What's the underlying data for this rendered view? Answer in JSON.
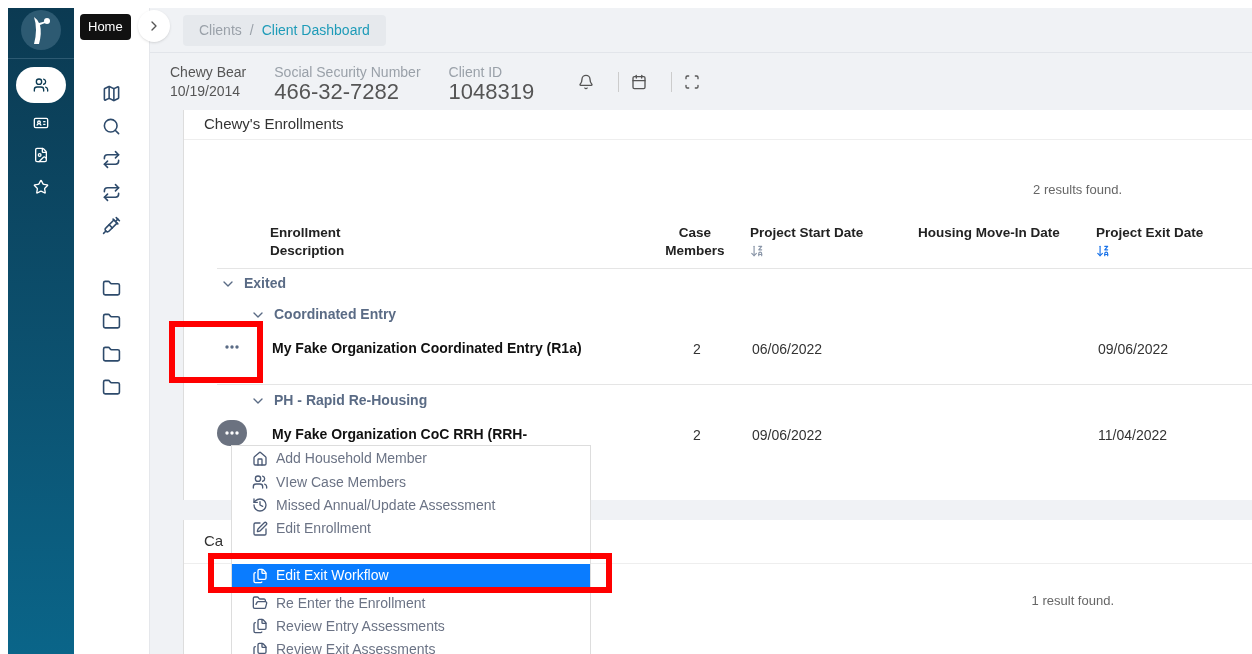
{
  "sidebar": {
    "items": [
      {
        "selected": true
      },
      {
        "selected": false
      },
      {
        "selected": false
      },
      {
        "selected": false
      }
    ]
  },
  "tooltip": "Home",
  "breadcrumb": [
    {
      "label": "Clients",
      "current": false
    },
    {
      "label": "/",
      "current": false
    },
    {
      "label": "Client Dashboard",
      "current": true
    }
  ],
  "client": {
    "name": "Chewy Bear",
    "dob": "10/19/2014",
    "fields": [
      {
        "label": "Social Security Number",
        "value": "466-32-7282"
      },
      {
        "label": "Client ID",
        "value": "1048319"
      }
    ]
  },
  "enrollments": {
    "title": "Chewy's Enrollments",
    "results": "2 results found.",
    "columns": [
      {
        "label": "Enrollment Description"
      },
      {
        "label": "Case Members"
      },
      {
        "label": "Project Start Date",
        "sorted": false
      },
      {
        "label": "Housing Move-In Date"
      },
      {
        "label": "Project Exit Date",
        "sorted": true
      }
    ],
    "groups": [
      {
        "label": "Exited",
        "expanded": true,
        "children": [
          {
            "label": "Coordinated Entry",
            "expanded": true,
            "rows": [
              {
                "description": "My Fake Organization Coordinated Entry (R1a)",
                "case_members": "2",
                "start": "06/06/2022",
                "exit": "09/06/2022",
                "menu_open": false,
                "highlighted": true
              }
            ]
          },
          {
            "label": "PH - Rapid Re-Housing",
            "expanded": true,
            "rows": [
              {
                "description": "My Fake Organization CoC RRH (RRH-",
                "case_members": "2",
                "start": "09/06/2022",
                "exit": "11/04/2022",
                "menu_open": true,
                "highlighted": false
              }
            ]
          }
        ]
      }
    ]
  },
  "row_menu": {
    "items": [
      {
        "label": "Add Household Member",
        "selected": false,
        "highlighted": false
      },
      {
        "label": "VIew Case Members",
        "selected": false,
        "highlighted": false
      },
      {
        "label": "Missed Annual/Update Assessment",
        "selected": false,
        "highlighted": false
      },
      {
        "label": "Edit Enrollment",
        "selected": false,
        "highlighted": false
      },
      {
        "label": "Edit Exit Workflow",
        "selected": true,
        "highlighted": true
      },
      {
        "label": "Re Enter the Enrollment",
        "selected": false,
        "highlighted": false
      },
      {
        "label": "Review Entry Assessments",
        "selected": false,
        "highlighted": false
      },
      {
        "label": "Review Exit Assessments",
        "selected": false,
        "highlighted": false
      }
    ]
  },
  "second_card": {
    "title": "Ca",
    "results": "1 result found."
  }
}
